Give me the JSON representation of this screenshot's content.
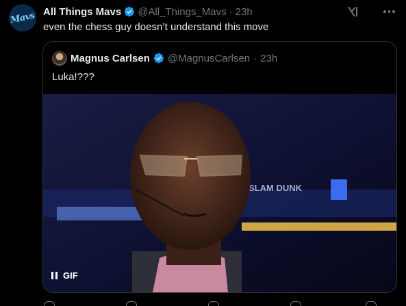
{
  "post": {
    "author_name": "All Things Mavs",
    "author_handle": "@All_Things_Mavs",
    "separator": "·",
    "time": "23h",
    "text": "even the chess guy doesn’t understand this move",
    "avatar_text": "Mavs"
  },
  "quoted_post": {
    "author_name": "Magnus Carlsen",
    "author_handle": "@MagnusCarlsen",
    "separator": "·",
    "time": "23h",
    "text": "Luka!???",
    "media": {
      "type": "gif",
      "badge_label": "GIF",
      "state": "playing",
      "background_sign": "SLAM DUNK"
    }
  },
  "colors": {
    "background": "#000000",
    "text_primary": "#e7e9ea",
    "text_secondary": "#71767b",
    "verified_blue": "#1d9bf0",
    "border": "#2f3336"
  },
  "icons": {
    "verified": "verified-badge-icon",
    "grok": "grok-icon",
    "more": "more-options-icon",
    "pause": "pause-icon"
  }
}
